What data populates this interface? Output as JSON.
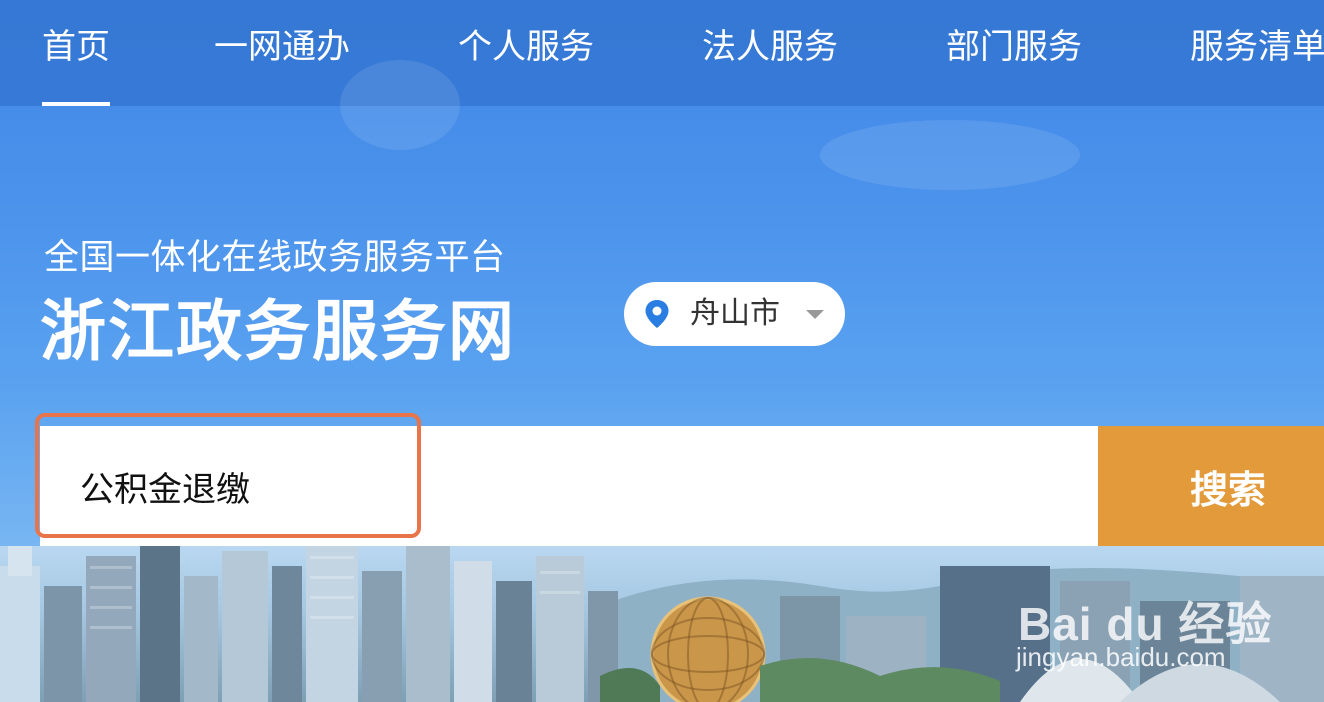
{
  "nav": {
    "items": [
      {
        "label": "首页",
        "active": true
      },
      {
        "label": "一网通办"
      },
      {
        "label": "个人服务"
      },
      {
        "label": "法人服务"
      },
      {
        "label": "部门服务"
      },
      {
        "label": "服务清单"
      }
    ]
  },
  "header": {
    "subtitle": "全国一体化在线政务服务平台",
    "title": "浙江政务服务网"
  },
  "location": {
    "icon": "location-pin-icon",
    "city": "舟山市",
    "caret_icon": "caret-down-icon"
  },
  "search": {
    "value": "公积金退缴",
    "button_label": "搜索"
  },
  "watermark": {
    "brand": "Bai du 经验",
    "url": "jingyan.baidu.com"
  },
  "colors": {
    "nav_bg": "#3476d3",
    "search_button": "#e39a3b",
    "highlight_border": "#e8744a",
    "pin": "#2a7de1"
  }
}
